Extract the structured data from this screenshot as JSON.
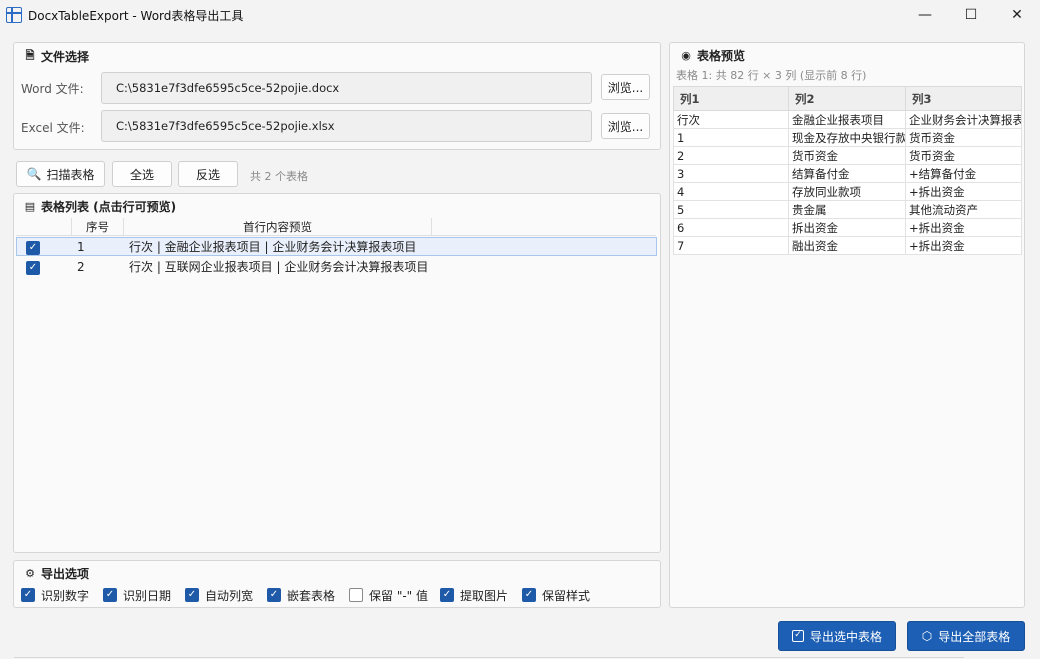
{
  "window": {
    "title": "DocxTableExport - Word表格导出工具",
    "minimize_glyph": "—",
    "maximize_glyph": "☐",
    "close_glyph": "✕"
  },
  "file_select": {
    "title": "文件选择",
    "word_label": "Word 文件:",
    "word_path": "C:\\5831e7f3dfe6595c5ce-52pojie.docx",
    "excel_label": "Excel 文件:",
    "excel_path": "C:\\5831e7f3dfe6595c5ce-52pojie.xlsx",
    "browse_label": "浏览..."
  },
  "toolbar": {
    "scan_label": "扫描表格",
    "select_all_label": "全选",
    "invert_label": "反选",
    "count_text": "共 2 个表格"
  },
  "table_list": {
    "title": "表格列表 (点击行可预览)",
    "headers": [
      "序号",
      "首行内容预览"
    ],
    "rows": [
      {
        "checked": true,
        "index": "1",
        "preview": "行次 | 金融企业报表项目 | 企业财务会计决算报表项目"
      },
      {
        "checked": true,
        "index": "2",
        "preview": "行次 | 互联网企业报表项目 | 企业财务会计决算报表项目"
      }
    ]
  },
  "export_options": {
    "title": "导出选项",
    "options": [
      {
        "label": "识别数字",
        "checked": true
      },
      {
        "label": "识别日期",
        "checked": true
      },
      {
        "label": "自动列宽",
        "checked": true
      },
      {
        "label": "嵌套表格",
        "checked": true
      },
      {
        "label": "保留 \"-\" 值",
        "checked": false
      },
      {
        "label": "提取图片",
        "checked": true
      },
      {
        "label": "保留样式",
        "checked": true
      }
    ]
  },
  "preview": {
    "title": "表格预览",
    "info": "表格 1: 共 82 行 × 3 列 (显示前 8 行)",
    "columns": [
      "列1",
      "列2",
      "列3"
    ],
    "rows": [
      [
        "行次",
        "金融企业报表项目",
        "企业财务会计决算报表项目"
      ],
      [
        "1",
        "现金及存放中央银行款项",
        "货币资金"
      ],
      [
        "2",
        "货币资金",
        "货币资金"
      ],
      [
        "3",
        "结算备付金",
        "+结算备付金"
      ],
      [
        "4",
        "存放同业款项",
        "+拆出资金"
      ],
      [
        "5",
        "贵金属",
        "其他流动资产"
      ],
      [
        "6",
        "拆出资金",
        "+拆出资金"
      ],
      [
        "7",
        "融出资金",
        "+拆出资金"
      ]
    ]
  },
  "actions": {
    "export_selected_label": "导出选中表格",
    "export_all_label": "导出全部表格"
  },
  "colors": {
    "accent": "#1d5fb4",
    "checkbox": "#1f5aa8",
    "selected_row": "#e9f0fb"
  }
}
